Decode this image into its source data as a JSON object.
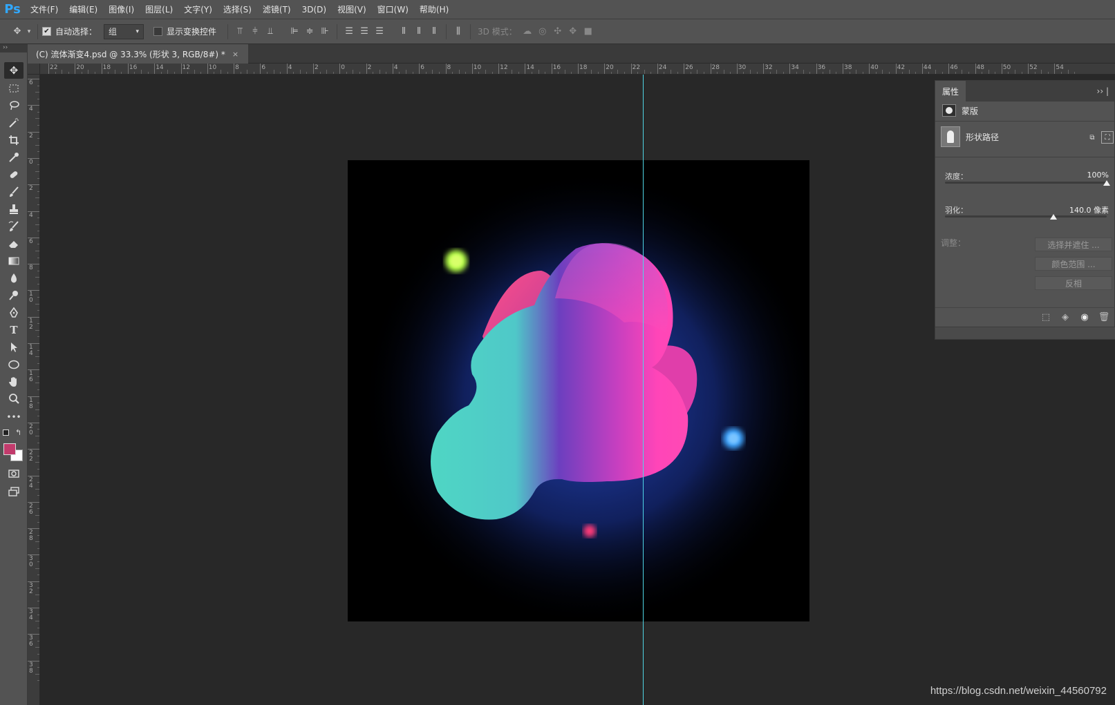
{
  "app": {
    "logo": "Ps"
  },
  "menu": [
    "文件(F)",
    "编辑(E)",
    "图像(I)",
    "图层(L)",
    "文字(Y)",
    "选择(S)",
    "滤镜(T)",
    "3D(D)",
    "视图(V)",
    "窗口(W)",
    "帮助(H)"
  ],
  "options": {
    "auto_select_label": "自动选择：",
    "auto_select_checked": true,
    "auto_select_value": "组",
    "show_transform_label": "显示变换控件",
    "show_transform_checked": false,
    "mode_3d_label": "3D 模式："
  },
  "document": {
    "tab_title": "(C) 流体渐变4.psd @ 33.3% (形状 3, RGB/8#) *",
    "close": "×"
  },
  "ruler": {
    "h_labels": [
      "22",
      "20",
      "18",
      "16",
      "14",
      "12",
      "10",
      "8",
      "6",
      "4",
      "2",
      "0",
      "2",
      "4",
      "6",
      "8",
      "10",
      "12",
      "14",
      "16",
      "18",
      "20",
      "22",
      "24",
      "26",
      "28",
      "30",
      "32",
      "34",
      "36",
      "38",
      "40",
      "42",
      "44",
      "46",
      "48",
      "50",
      "52",
      "54"
    ],
    "v_labels": [
      "6",
      "4",
      "2",
      "0",
      "2",
      "4",
      "6",
      "8",
      "1 0",
      "1 2",
      "1 4",
      "1 6",
      "1 8",
      "2 0",
      "2 2",
      "2 4",
      "2 6",
      "2 8",
      "3 0",
      "3 2",
      "3 4",
      "3 6",
      "3 8"
    ]
  },
  "colors": {
    "foreground": "#c23b6c",
    "background": "#ffffff",
    "guide": "#4fd6e6",
    "blob_teal": "#4fd6c4",
    "blob_purple": "#6c3fbf",
    "blob_pink": "#ff45b8",
    "glow_blue": "#2a4fcf"
  },
  "properties": {
    "tab": "属性",
    "menu": "›› |",
    "mask_label": "蒙版",
    "shape_path_label": "形状路径",
    "density_label": "浓度：",
    "density_value": "100%",
    "density_fraction": 1.0,
    "feather_label": "羽化：",
    "feather_value": "140.0 像素",
    "feather_fraction": 0.67,
    "adjust_label": "调整：",
    "buttons": [
      "选择并遮住 ...",
      "颜色范围 ...",
      "反相"
    ]
  },
  "watermark": "https://blog.csdn.net/weixin_44560792"
}
